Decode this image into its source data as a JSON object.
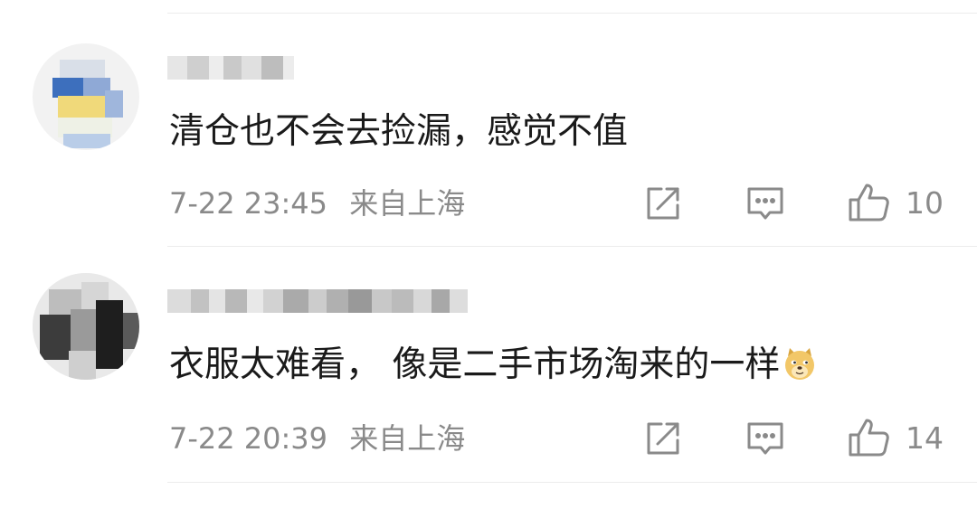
{
  "comments": [
    {
      "username": "",
      "text": "清仓也不会去捡漏，感觉不值",
      "time": "7-22 23:45",
      "location": "来自上海",
      "likes": "10"
    },
    {
      "username": "",
      "text": "衣服太难看， 像是二手市场淘来的一样",
      "time": "7-22 20:39",
      "location": "来自上海",
      "likes": "14",
      "emoji": "doge-emoji"
    }
  ],
  "icons": {
    "share": "share-icon",
    "reply": "reply-comment-icon",
    "like": "thumbs-up-icon"
  },
  "colors": {
    "text": "#1a1a1a",
    "meta": "#8a8a8a",
    "divider": "#ececec"
  }
}
